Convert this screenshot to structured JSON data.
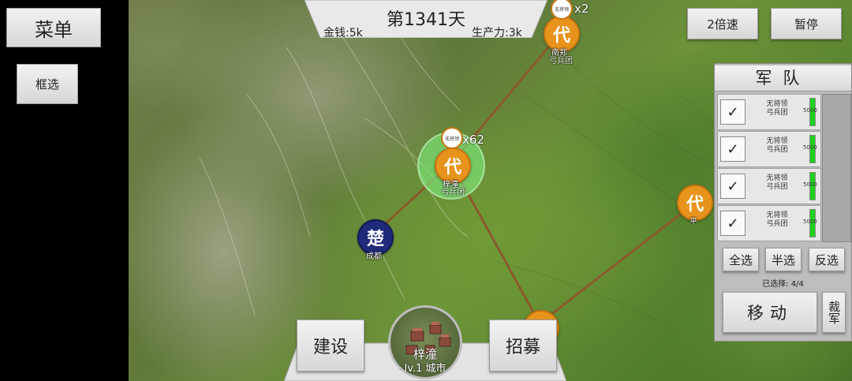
{
  "left_panel": {
    "menu_label": "菜单",
    "box_select_label": "框选"
  },
  "top": {
    "day": "第1341天",
    "money": "金钱:5k",
    "production": "生产力:3k"
  },
  "speed_button": "2倍速",
  "pause_button": "暂停",
  "map": {
    "cities": [
      {
        "glyph": "代",
        "name": "南郑",
        "sub": "弓兵团"
      },
      {
        "glyph": "代",
        "name": "梓潼",
        "sub": "弓兵团"
      },
      {
        "glyph": "楚",
        "name": "成都"
      },
      {
        "glyph": "代",
        "name": "平"
      }
    ],
    "armies": [
      {
        "bubble": "无将领",
        "count": "x2"
      },
      {
        "bubble": "无将领",
        "count": "x62"
      }
    ],
    "colors": {
      "orange": "#e8941c",
      "blue": "#1f2a7a"
    }
  },
  "army_panel": {
    "title": "军队",
    "rows": [
      {
        "name": "无将领",
        "unit": "弓兵团",
        "number": "5000",
        "checked": true,
        "fill": 1.0
      },
      {
        "name": "无将领",
        "unit": "弓兵团",
        "number": "5000",
        "checked": true,
        "fill": 1.0
      },
      {
        "name": "无将领",
        "unit": "弓兵团",
        "number": "5000",
        "checked": true,
        "fill": 1.0
      },
      {
        "name": "无将领",
        "unit": "弓兵团",
        "number": "5000",
        "checked": true,
        "fill": 1.0
      }
    ],
    "select_all": "全选",
    "select_half": "半选",
    "select_invert": "反选",
    "selected_label": "已选择:",
    "selected_value": "4/4",
    "move": "移动",
    "disband": "裁军"
  },
  "bottom": {
    "build": "建设",
    "recruit": "招募",
    "city_name": "梓潼",
    "city_level": "lv.1 城市"
  }
}
